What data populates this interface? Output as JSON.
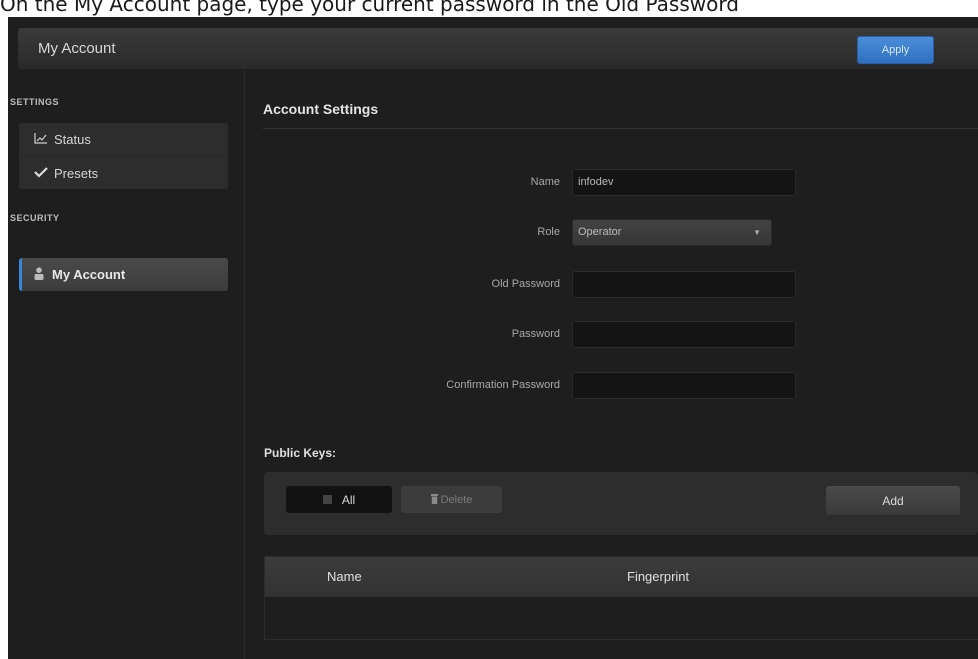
{
  "caption": "On the My Account page, type your current password in the Old Password",
  "header": {
    "title": "My Account",
    "apply_label": "Apply"
  },
  "sidebar": {
    "settings_label": "SETTINGS",
    "settings_items": [
      {
        "label": "Status",
        "icon": "chart-icon"
      },
      {
        "label": "Presets",
        "icon": "checkmark-icon"
      }
    ],
    "security_label": "SECURITY",
    "security_items": [
      {
        "label": "My Account",
        "icon": "user-icon",
        "active": true
      }
    ]
  },
  "main": {
    "title": "Account Settings",
    "form": {
      "name_label": "Name",
      "name_value": "infodev",
      "role_label": "Role",
      "role_value": "Operator",
      "old_password_label": "Old Password",
      "old_password_value": "",
      "password_label": "Password",
      "password_value": "",
      "confirm_label": "Confirmation Password",
      "confirm_value": ""
    },
    "public_keys": {
      "label": "Public Keys:",
      "all_label": "All",
      "delete_label": "Delete",
      "add_label": "Add",
      "columns": [
        "Name",
        "Fingerprint"
      ],
      "rows": []
    }
  },
  "colors": {
    "accent": "#3a86d8",
    "background": "#1e1e1e",
    "panel": "#2d2d2d"
  }
}
